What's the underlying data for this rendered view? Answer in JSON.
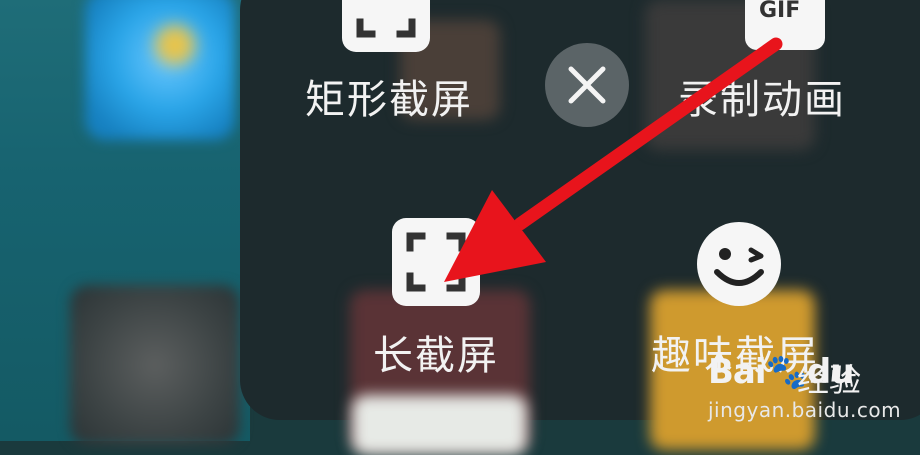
{
  "screenshot_menu": {
    "close_icon": "close-icon",
    "items": [
      {
        "label": "矩形截屏",
        "icon": "rect-capture-icon"
      },
      {
        "label": "录制动画",
        "icon": "gif-icon",
        "badge": "GIF"
      },
      {
        "label": "长截屏",
        "icon": "long-capture-icon"
      },
      {
        "label": "趣味截屏",
        "icon": "smiley-icon"
      }
    ]
  },
  "annotation": {
    "arrow_color": "#e8141c"
  },
  "watermark": {
    "brand": "Bai",
    "brand_suffix": "du",
    "title": "经验",
    "url": "jingyan.baidu.com"
  },
  "colors": {
    "panel": "#1d2a2d",
    "close_button": "#5b6467",
    "icon_tile": "#f6f6f6"
  }
}
